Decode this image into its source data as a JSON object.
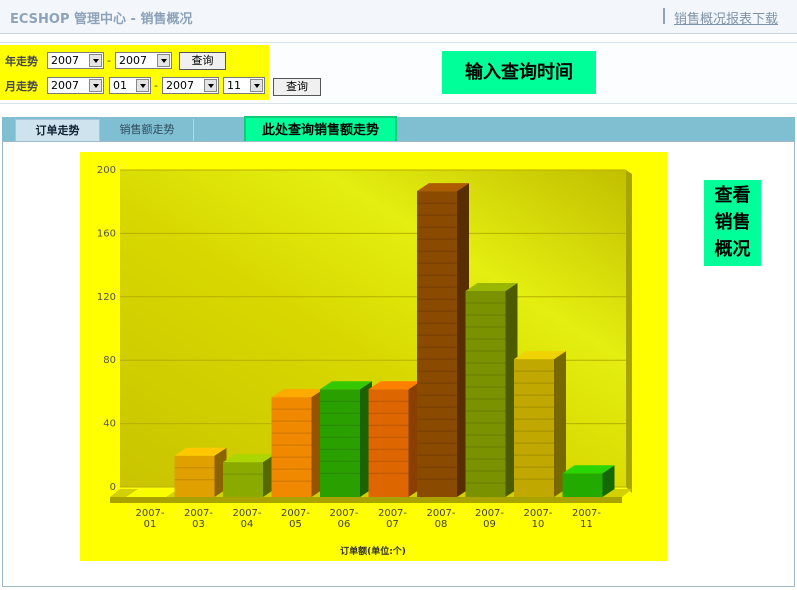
{
  "header": {
    "title": "ECSHOP 管理中心 - 销售概况",
    "download_link": "销售概况报表下载"
  },
  "query": {
    "year_label": "年走势",
    "year_from": "2007",
    "year_to": "2007",
    "month_label": "月走势",
    "month_from_year": "2007",
    "month_from_month": "01",
    "month_to_year": "2007",
    "month_to_month": "11",
    "dash": "-",
    "query_button": "查询"
  },
  "notes": {
    "time": "输入查询时间",
    "trend": "此处查询销售额走势",
    "overview_line1": "查看",
    "overview_line2": "销售",
    "overview_line3": "概况"
  },
  "tabs": {
    "orders": "订单走势",
    "sales": "销售额走势"
  },
  "chart_data": {
    "type": "bar",
    "categories": [
      "2007-01",
      "2007-03",
      "2007-04",
      "2007-05",
      "2007-06",
      "2007-07",
      "2007-08",
      "2007-09",
      "2007-10",
      "2007-11"
    ],
    "category_lines": [
      [
        "2007-",
        "01"
      ],
      [
        "2007-",
        "03"
      ],
      [
        "2007-",
        "04"
      ],
      [
        "2007-",
        "05"
      ],
      [
        "2007-",
        "06"
      ],
      [
        "2007-",
        "07"
      ],
      [
        "2007-",
        "08"
      ],
      [
        "2007-",
        "09"
      ],
      [
        "2007-",
        "10"
      ],
      [
        "2007-",
        "11"
      ]
    ],
    "values": [
      0,
      26,
      22,
      63,
      68,
      68,
      193,
      130,
      87,
      15
    ],
    "xlabel": "订单额(单位:个)",
    "ylim": [
      0,
      200
    ],
    "yticks": [
      0,
      40,
      80,
      120,
      160,
      200
    ],
    "grid": true,
    "colors": [
      "#c8d000",
      "#e0a000",
      "#8aaa00",
      "#f08800",
      "#2aa000",
      "#dd6600",
      "#8a4a00",
      "#7a9200",
      "#c0a800",
      "#22aa00"
    ],
    "background_color": "#ffff00"
  }
}
